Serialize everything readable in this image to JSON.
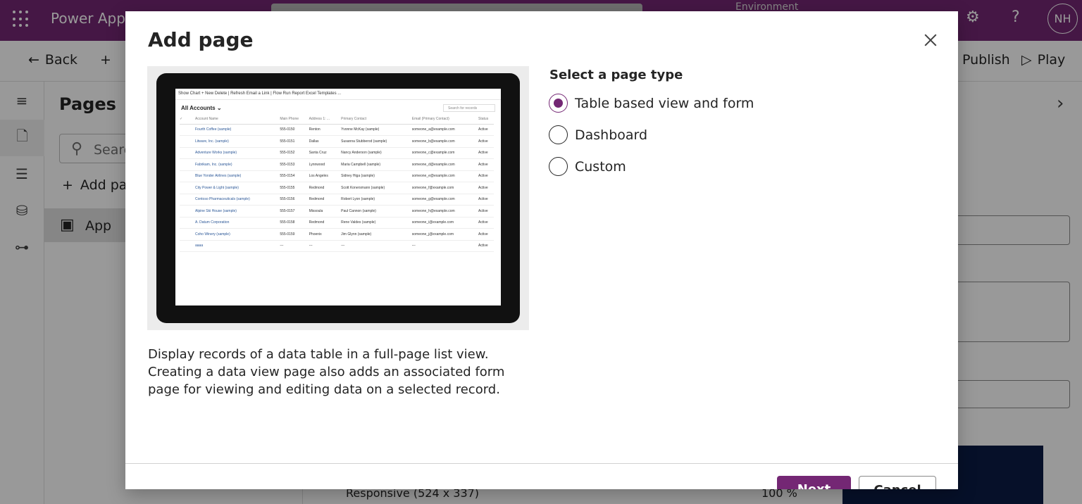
{
  "topbar": {
    "app_title": "Power Apps",
    "environment_label": "Environment",
    "avatar_initials": "NH"
  },
  "cmdbar": {
    "back": "Back",
    "publish": "Publish",
    "play": "Play"
  },
  "pages_panel": {
    "title": "Pages",
    "search_placeholder": "Search",
    "add_page": "Add page",
    "app_item": "App"
  },
  "canvas": {
    "responsive": "Responsive (524 x 337)",
    "zoom": "100 %"
  },
  "dialog": {
    "title": "Add page",
    "description": "Display records of a data table in a full-page list view. Creating a data view page also adds an associated form page for viewing and editing data on a selected record.",
    "section_label": "Select a page type",
    "options": [
      {
        "label": "Table based view and form",
        "selected": true
      },
      {
        "label": "Dashboard",
        "selected": false
      },
      {
        "label": "Custom",
        "selected": false
      }
    ],
    "next_button": "Next",
    "cancel_button": "Cancel"
  },
  "preview": {
    "toolbar": "Show Chart   + New   Delete   |   Refresh   Email a Link   |   Flow   Run Report   Excel Templates   ...",
    "view_name": "All Accounts",
    "search_placeholder": "Search for records",
    "columns": [
      "Account Name",
      "Main Phone",
      "Address 1: ...",
      "Primary Contact",
      "Email (Primary Contact)",
      "Status"
    ],
    "rows": [
      [
        "Fourth Coffee (sample)",
        "555-0150",
        "Renton",
        "Yvonne McKay (sample)",
        "someone_a@example.com",
        "Active"
      ],
      [
        "Litware, Inc. (sample)",
        "555-0151",
        "Dallas",
        "Susanna Stubberod (sample)",
        "someone_b@example.com",
        "Active"
      ],
      [
        "Adventure Works (sample)",
        "555-0152",
        "Santa Cruz",
        "Nancy Anderson (sample)",
        "someone_c@example.com",
        "Active"
      ],
      [
        "Fabrikam, Inc. (sample)",
        "555-0153",
        "Lynnwood",
        "Maria Campbell (sample)",
        "someone_d@example.com",
        "Active"
      ],
      [
        "Blue Yonder Airlines (sample)",
        "555-0154",
        "Los Angeles",
        "Sidney Higa (sample)",
        "someone_e@example.com",
        "Active"
      ],
      [
        "City Power & Light (sample)",
        "555-0155",
        "Redmond",
        "Scott Konersmann (sample)",
        "someone_f@example.com",
        "Active"
      ],
      [
        "Contoso Pharmaceuticals (sample)",
        "555-0156",
        "Redmond",
        "Robert Lyon (sample)",
        "someone_g@example.com",
        "Active"
      ],
      [
        "Alpine Ski House (sample)",
        "555-0157",
        "Missoula",
        "Paul Cannon (sample)",
        "someone_h@example.com",
        "Active"
      ],
      [
        "A. Datum Corporation",
        "555-0158",
        "Redmond",
        "Rene Valdes (sample)",
        "someone_i@example.com",
        "Active"
      ],
      [
        "Coho Winery (sample)",
        "555-0159",
        "Phoenix",
        "Jim Glynn (sample)",
        "someone_j@example.com",
        "Active"
      ],
      [
        "aaaa",
        "---",
        "---",
        "---",
        "---",
        "Active"
      ]
    ]
  },
  "colors": {
    "brand": "#742774",
    "scrim": "rgba(0,0,0,0.4)"
  }
}
